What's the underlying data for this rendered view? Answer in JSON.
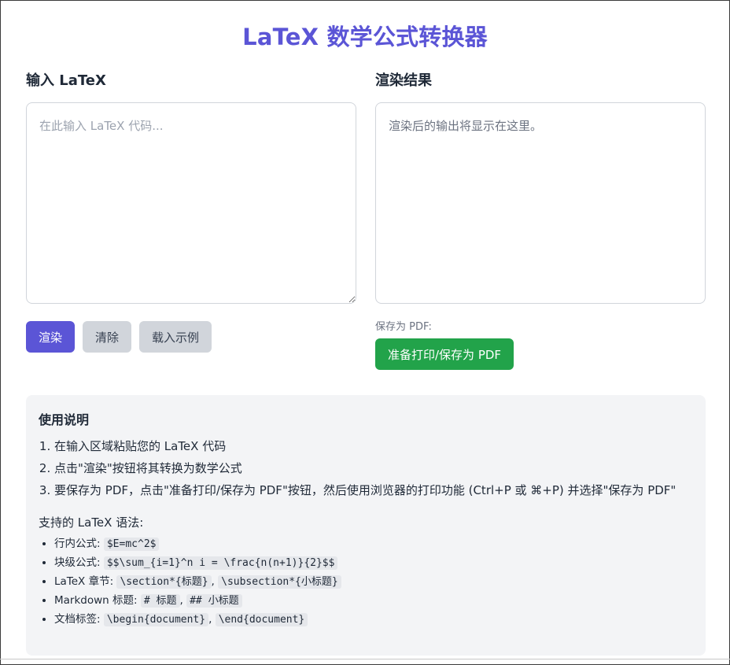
{
  "title": "LaTeX 数学公式转换器",
  "input": {
    "heading": "输入 LaTeX",
    "placeholder": "在此输入 LaTeX 代码..."
  },
  "output": {
    "heading": "渲染结果",
    "empty_hint": "渲染后的输出将显示在这里。"
  },
  "buttons": {
    "render": "渲染",
    "clear": "清除",
    "load_example": "载入示例",
    "pdf_label": "保存为 PDF:",
    "print_pdf": "准备打印/保存为 PDF"
  },
  "help": {
    "title": "使用说明",
    "steps": [
      "在输入区域粘贴您的 LaTeX 代码",
      "点击\"渲染\"按钮将其转换为数学公式",
      "要保存为 PDF，点击\"准备打印/保存为 PDF\"按钮，然后使用浏览器的打印功能 (Ctrl+P 或 ⌘+P) 并选择\"保存为 PDF\""
    ],
    "syntax_title": "支持的 LaTeX 语法:",
    "syntax": [
      {
        "label": "行内公式:",
        "codes": [
          "$E=mc^2$"
        ]
      },
      {
        "label": "块级公式:",
        "codes": [
          "$$\\sum_{i=1}^n i = \\frac{n(n+1)}{2}$$"
        ]
      },
      {
        "label": "LaTeX 章节:",
        "codes": [
          "\\section*{标题}",
          "\\subsection*{小标题}"
        ]
      },
      {
        "label": "Markdown 标题:",
        "codes": [
          "# 标题",
          "## 小标题"
        ]
      },
      {
        "label": "文档标签:",
        "codes": [
          "\\begin{document}",
          "\\end{document}"
        ]
      }
    ]
  },
  "colors": {
    "accent": "#5b55d6",
    "success": "#22a34a",
    "gray_button": "#d1d5db",
    "help_bg": "#f3f4f6"
  }
}
